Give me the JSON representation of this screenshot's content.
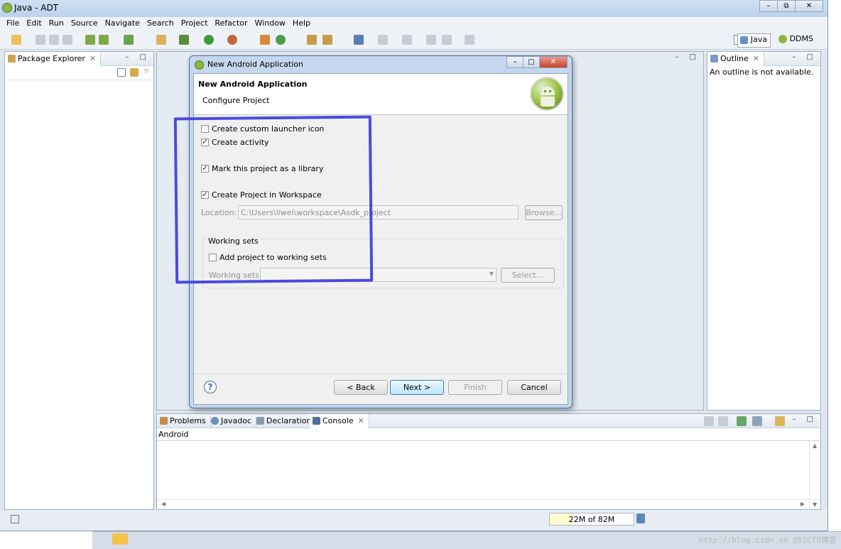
{
  "window": {
    "title": "Java - ADT",
    "minimize": "–",
    "restore": "⧉",
    "close": "✕"
  },
  "menu": [
    "File",
    "Edit",
    "Run",
    "Source",
    "Navigate",
    "Search",
    "Project",
    "Refactor",
    "Window",
    "Help"
  ],
  "perspectives": {
    "java": "Java",
    "ddms": "DDMS"
  },
  "package_explorer": {
    "title": "Package Explorer",
    "close": "✕",
    "min_max": "– □"
  },
  "outline": {
    "title": "Outline",
    "close": "✕",
    "message": "An outline is not available.",
    "min_max": "– □"
  },
  "console_panel": {
    "tabs": [
      {
        "label": "Problems"
      },
      {
        "label": "Javadoc"
      },
      {
        "label": "Declaration"
      },
      {
        "label": "Console",
        "close": "✕"
      }
    ],
    "name": "Android",
    "min_max": "– □"
  },
  "status": {
    "heap": "22M of 82M",
    "heap_used_fraction": 0.27
  },
  "dialog": {
    "title": "New Android Application",
    "minimize": "–",
    "restore": "□",
    "close": "✕",
    "banner_title": "New Android Application",
    "banner_subtitle": "Configure Project",
    "options": {
      "custom_launcher_icon": {
        "label": "Create custom launcher icon",
        "checked": false
      },
      "create_activity": {
        "label": "Create activity",
        "checked": true
      },
      "mark_library": {
        "label": "Mark this project as a library",
        "checked": true
      },
      "create_in_workspace": {
        "label": "Create Project in Workspace",
        "checked": true
      }
    },
    "location": {
      "label": "Location:",
      "value": "C:\\Users\\liwei\\workspace\\Asdk_project",
      "browse": "Browse..."
    },
    "working_sets": {
      "group_label": "Working sets",
      "add_label": "Add project to working sets",
      "add_checked": false,
      "sets_label": "Working sets:",
      "select": "Select..."
    },
    "help": "?",
    "buttons": {
      "back": "< Back",
      "next": "Next >",
      "finish": "Finish",
      "cancel": "Cancel"
    }
  },
  "watermark": "http://blog.csdn.ne @51CTO博客",
  "colors": {
    "highlight": "#4a4adf",
    "android_green": "#a4c94d",
    "ide_background": "#dfe6ef"
  }
}
